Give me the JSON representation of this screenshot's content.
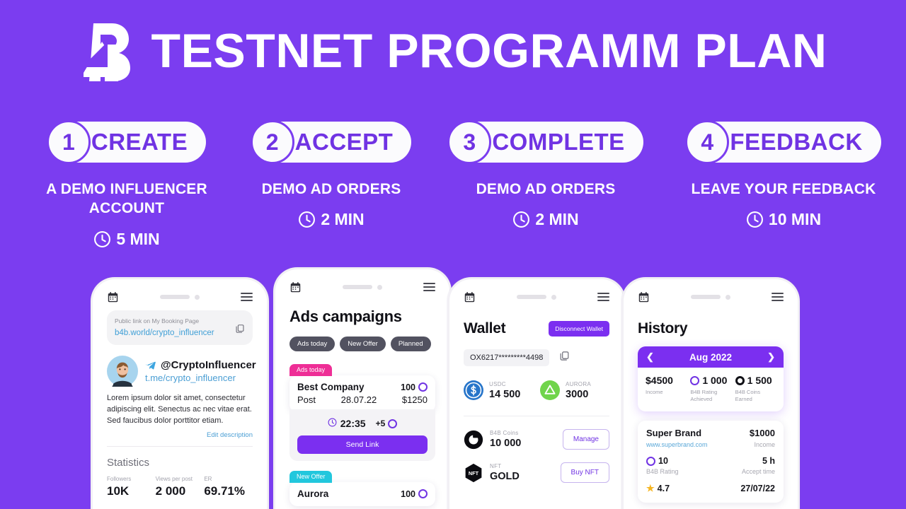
{
  "colors": {
    "background": "#7B3DF0",
    "accent": "#7033E3",
    "button": "#7B2FF0",
    "pink": "#EE2E96",
    "cyan": "#22C7DD"
  },
  "header": {
    "title": "TESTNET PROGRAMM PLAN",
    "logo_icon": "b4-logo-icon"
  },
  "steps": [
    {
      "number": "1",
      "label": "CREATE",
      "subtitle": "A DEMO INFLUENCER\nACCOUNT",
      "time": "5 MIN",
      "clock_icon": "clock-icon"
    },
    {
      "number": "2",
      "label": "ACCEPT",
      "subtitle": "DEMO AD ORDERS",
      "time": "2 MIN",
      "clock_icon": "clock-icon"
    },
    {
      "number": "3",
      "label": "COMPLETE",
      "subtitle": "DEMO AD ORDERS",
      "time": "2 MIN",
      "clock_icon": "clock-icon"
    },
    {
      "number": "4",
      "label": "FEEDBACK",
      "subtitle": "LEAVE YOUR FEEDBACK",
      "time": "10 MIN",
      "clock_icon": "clock-icon"
    }
  ],
  "phone1": {
    "calendar_icon": "calendar-icon",
    "menu_icon": "hamburger-menu-icon",
    "link_label": "Public link on My Booking Page",
    "link_url": "b4b.world/crypto_influencer",
    "copy_icon": "copy-icon",
    "telegram_icon": "telegram-icon",
    "handle": "@CryptoInfluencer",
    "tme": "t.me/crypto_influencer",
    "bio": "Lorem ipsum dolor sit amet, consectetur adipiscing elit. Senectus ac nec vitae erat. Sed faucibus dolor porttitor etiam.",
    "edit_link": "Edit description",
    "stats_title": "Statistics",
    "stats": [
      {
        "key": "Followers",
        "value": "10K"
      },
      {
        "key": "Views per post",
        "value": "2 000"
      },
      {
        "key": "ER",
        "value": "69.71%"
      }
    ]
  },
  "phone2": {
    "calendar_icon": "calendar-icon",
    "menu_icon": "hamburger-menu-icon",
    "title": "Ads campaigns",
    "chips": [
      "Ads today",
      "New Offer",
      "Planned"
    ],
    "orders": [
      {
        "tag": "Ads today",
        "tag_color": "pink",
        "company": "Best Company",
        "coins": "100",
        "type": "Post",
        "date": "28.07.22",
        "price": "$1250",
        "timer": "22:35",
        "bonus": "+5",
        "action": "Send Link"
      },
      {
        "tag": "New Offer",
        "tag_color": "cyan",
        "company": "Aurora",
        "coins": "100"
      }
    ]
  },
  "phone3": {
    "calendar_icon": "calendar-icon",
    "menu_icon": "hamburger-menu-icon",
    "title": "Wallet",
    "disconnect": "Disconnect Wallet",
    "address": "OX6217*********4498",
    "copy_icon": "copy-icon",
    "tokens": [
      {
        "name": "USDC",
        "amount": "14 500",
        "icon": "usdc-coin-icon"
      },
      {
        "name": "AURORA",
        "amount": "3000",
        "icon": "aurora-coin-icon"
      }
    ],
    "assets": [
      {
        "name": "B4B Coins",
        "value": "10 000",
        "action": "Manage",
        "icon": "b4b-coin-icon"
      },
      {
        "name": "NFT",
        "value": "GOLD",
        "action": "Buy NFT",
        "icon": "nft-hex-icon"
      }
    ]
  },
  "phone4": {
    "calendar_icon": "calendar-icon",
    "menu_icon": "hamburger-menu-icon",
    "title": "History",
    "month": "Aug 2022",
    "prev_icon": "chevron-left-icon",
    "next_icon": "chevron-right-icon",
    "month_stats": [
      {
        "value": "$4500",
        "label": "Income",
        "icon": "none"
      },
      {
        "value": "1 000",
        "label": "B4B Rating\nAchieved",
        "icon": "coin-ring-icon"
      },
      {
        "value": "1 500",
        "label": "B4B Coins\nEarned",
        "icon": "coin-black-icon"
      }
    ],
    "entry": {
      "brand": "Super Brand",
      "income": "$1000",
      "income_label": "Income",
      "site": "www.superbrand.com",
      "rating": "10",
      "rating_label": "B4B Rating",
      "accept_time": "5 h",
      "accept_label": "Accept time",
      "stars": "4.7",
      "date": "27/07/22"
    }
  }
}
